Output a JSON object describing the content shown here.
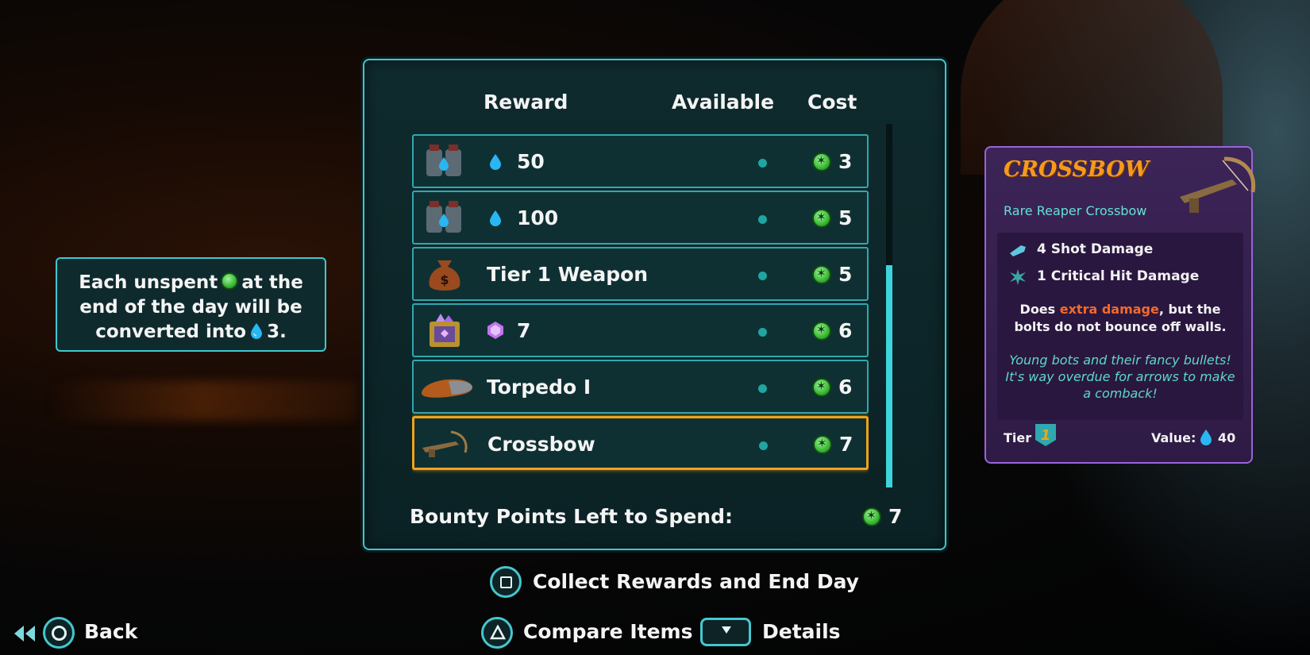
{
  "table": {
    "headers": {
      "reward": "Reward",
      "available": "Available",
      "cost": "Cost"
    },
    "rows": [
      {
        "icon": "water-canister-icon",
        "gem": "water-drop-icon",
        "name": "50",
        "cost": "3",
        "selected": false
      },
      {
        "icon": "water-canister-icon",
        "gem": "water-drop-icon",
        "name": "100",
        "cost": "5",
        "selected": false
      },
      {
        "icon": "money-bag-icon",
        "gem": "",
        "name": "Tier 1 Weapon",
        "cost": "5",
        "selected": false
      },
      {
        "icon": "gem-crate-icon",
        "gem": "purple-gem-icon",
        "name": "7",
        "cost": "6",
        "selected": false
      },
      {
        "icon": "torpedo-icon",
        "gem": "",
        "name": "Torpedo I",
        "cost": "6",
        "selected": false
      },
      {
        "icon": "crossbow-icon",
        "gem": "",
        "name": "Crossbow",
        "cost": "7",
        "selected": true
      }
    ],
    "bounty_label": "Bounty Points Left to Spend:",
    "bounty_value": "7"
  },
  "info": {
    "part1": "Each unspent",
    "part2": "at the",
    "line2": "end of the day will be",
    "part3": "converted into",
    "part4": "3."
  },
  "card": {
    "title": "CROSSBOW",
    "subtitle": "Rare Reaper Crossbow",
    "stat1": "4 Shot Damage",
    "stat2": "1 Critical Hit Damage",
    "desc_pre": "Does ",
    "desc_highlight": "extra damage",
    "desc_post": ", but the bolts do not bounce off walls.",
    "flavor": "Young bots and their fancy bullets! It's way overdue for arrows to make a comback!",
    "tier_label": "Tier",
    "tier_value": "1",
    "value_label": "Value:",
    "value": "40",
    "colors": {
      "title": "#f59a1c",
      "highlight": "#f26a2a",
      "flavor": "#5ed8c6",
      "rarity": "#9a63d8"
    }
  },
  "prompts": {
    "collect": "Collect Rewards and End Day",
    "back": "Back",
    "compare": "Compare Items",
    "details": "Details"
  },
  "colors": {
    "accent": "#3ec8cf",
    "selected": "#f0a21c",
    "coin": "#3fbd3a"
  }
}
